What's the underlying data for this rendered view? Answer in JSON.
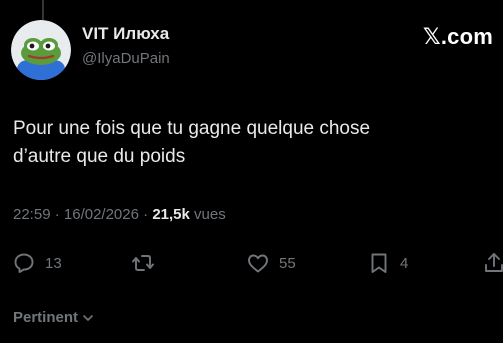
{
  "author": {
    "display_name": "VIT Илюха",
    "handle": "@IlyaDuPain",
    "avatar_icon": "pepe-frog-avatar"
  },
  "brand": {
    "text": "𝕏.com",
    "icon": "x-logo-icon"
  },
  "tweet": {
    "lines": [
      "Pour une fois que tu gagne quelque chose",
      "d’autre que du poids"
    ]
  },
  "meta": {
    "time": "22:59",
    "separator": "·",
    "date": "16/02/2026",
    "views_count": "21,5k",
    "views_label": "vues"
  },
  "actions": {
    "reply": {
      "icon": "reply-icon",
      "count": "13"
    },
    "retweet": {
      "icon": "retweet-icon",
      "count": ""
    },
    "like": {
      "icon": "heart-icon",
      "count": "55"
    },
    "bookmark": {
      "icon": "bookmark-icon",
      "count": "4"
    },
    "share": {
      "icon": "share-icon"
    }
  },
  "sort": {
    "label": "Pertinent",
    "icon": "chevron-down-icon"
  },
  "colors": {
    "background": "#000000",
    "text_primary": "#e7e9ea",
    "text_secondary": "#71767b"
  }
}
